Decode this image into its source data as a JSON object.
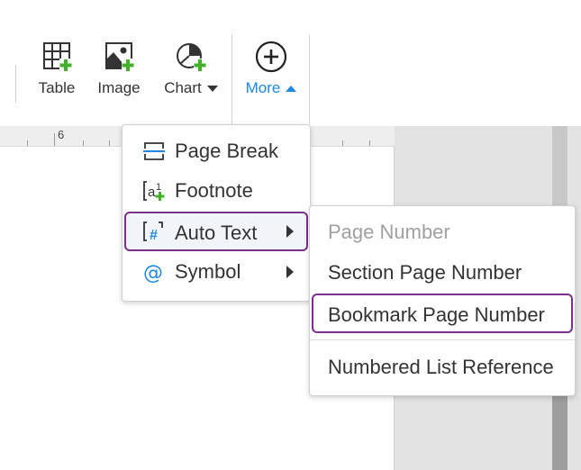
{
  "ribbon": {
    "buttons": [
      {
        "id": "table",
        "label": "Table",
        "icon": "table-add-icon"
      },
      {
        "id": "image",
        "label": "Image",
        "icon": "image-add-icon"
      },
      {
        "id": "chart",
        "label": "Chart",
        "icon": "chart-add-icon",
        "dropdown": "down"
      },
      {
        "id": "more",
        "label": "More",
        "icon": "plus-circle-icon",
        "dropdown": "up"
      }
    ]
  },
  "ruler": {
    "number": "6"
  },
  "insert_menu": {
    "items": [
      {
        "label": "Page Break",
        "icon": "page-break-icon",
        "submenu": false
      },
      {
        "label": "Footnote",
        "icon": "footnote-icon",
        "submenu": false
      },
      {
        "label": "Auto Text",
        "icon": "auto-text-icon",
        "submenu": true,
        "highlighted": true
      },
      {
        "label": "Symbol",
        "icon": "at-symbol-icon",
        "submenu": true
      }
    ]
  },
  "auto_text_submenu": {
    "items": [
      {
        "label": "Page Number",
        "disabled": true
      },
      {
        "label": "Section Page Number"
      },
      {
        "label": "Bookmark Page Number",
        "highlighted": true
      },
      {
        "label": "Numbered List Reference"
      }
    ]
  },
  "colors": {
    "accent_blue": "#1e88e5",
    "add_green": "#43b02a",
    "highlight_border": "#7b2f8e",
    "text": "#333333",
    "disabled_text": "#a0a0a0"
  }
}
